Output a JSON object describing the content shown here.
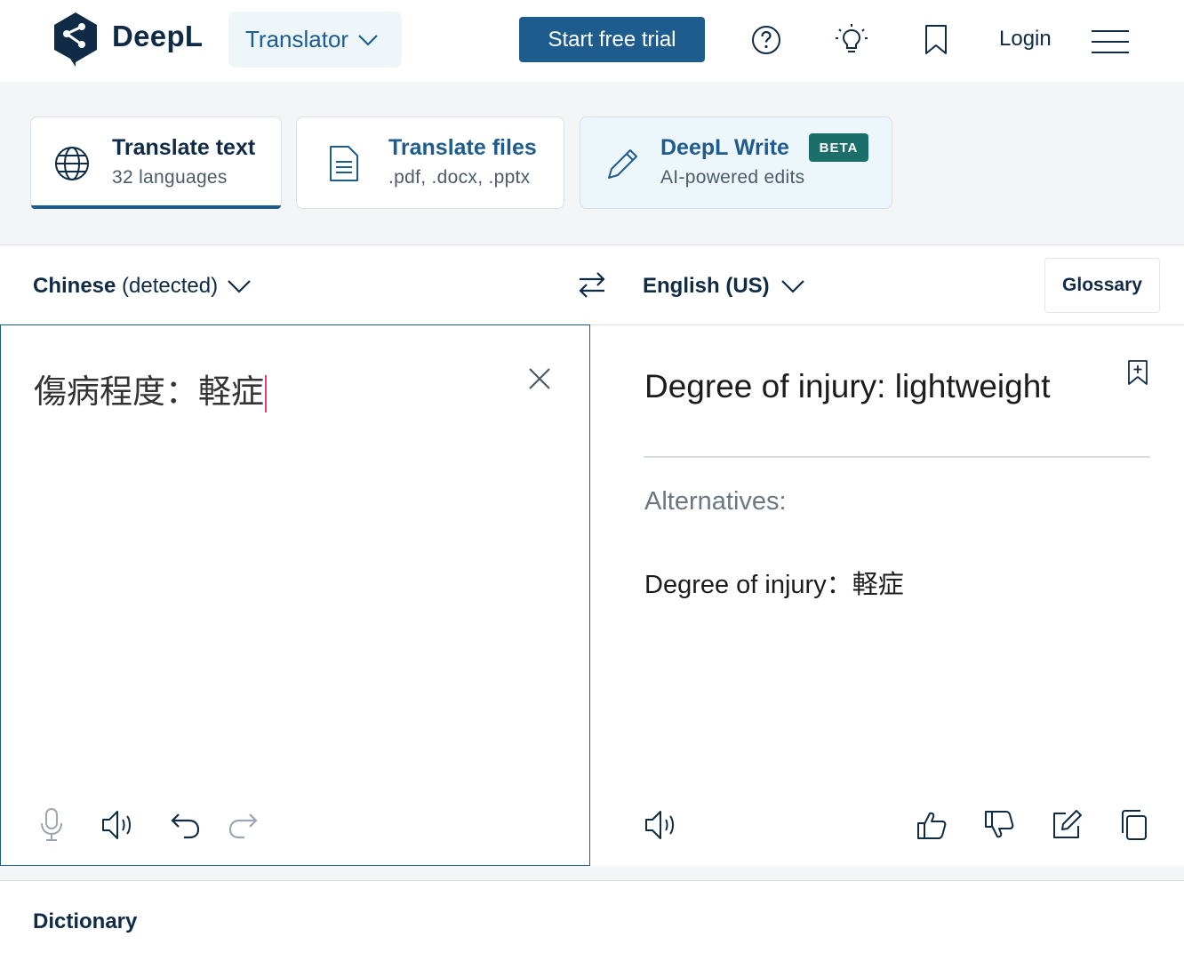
{
  "header": {
    "brand": "DeepL",
    "product_menu": "Translator",
    "trial_button": "Start free trial",
    "login": "Login",
    "icons": [
      "help-icon",
      "lightbulb-icon",
      "bookmark-icon",
      "menu-icon"
    ]
  },
  "modes": [
    {
      "title": "Translate text",
      "subtitle": "32 languages",
      "icon": "globe-icon",
      "active": true
    },
    {
      "title": "Translate files",
      "subtitle": ".pdf, .docx, .pptx",
      "icon": "document-icon",
      "active": false
    },
    {
      "title": "DeepL Write",
      "subtitle": "AI-powered edits",
      "badge": "BETA",
      "icon": "pencil-icon",
      "active": false
    }
  ],
  "languages": {
    "source_name": "Chinese",
    "source_note": "(detected)",
    "target": "English (US)",
    "glossary": "Glossary"
  },
  "source": {
    "text": "傷病程度：軽症"
  },
  "target": {
    "translation": "Degree of injury: lightweight",
    "alternatives_label": "Alternatives:",
    "alternatives": [
      "Degree of injury：軽症"
    ]
  },
  "dictionary": {
    "title": "Dictionary"
  },
  "colors": {
    "brand_navy": "#0f2b46",
    "accent_blue": "#1f5c8e",
    "beta_green": "#1b6e6a",
    "caret_pink": "#e0417a"
  }
}
